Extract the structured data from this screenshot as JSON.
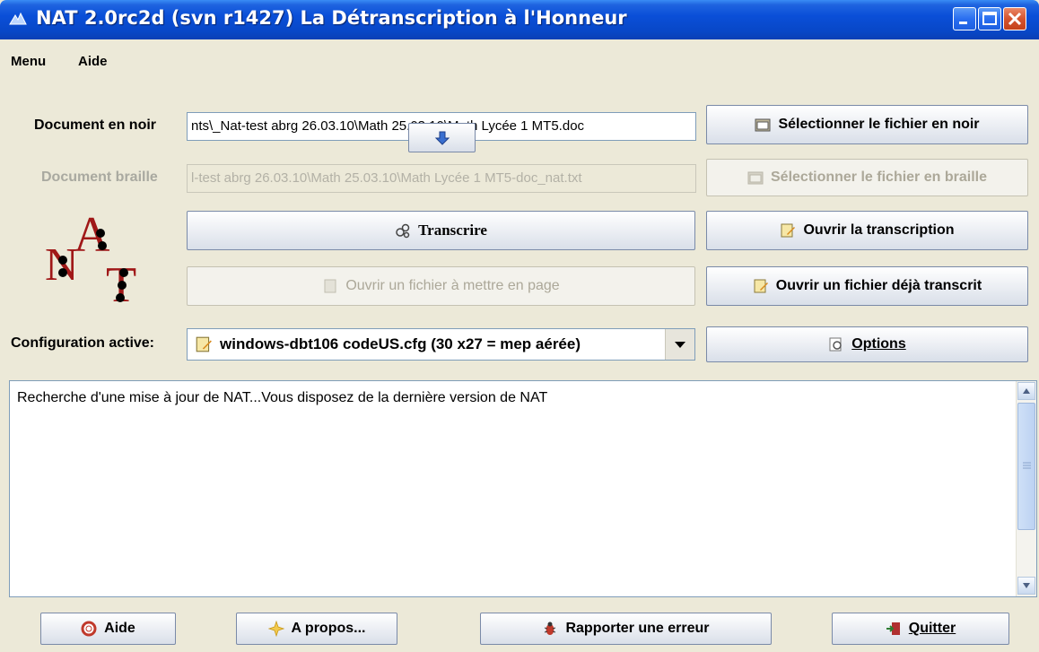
{
  "window": {
    "title": "NAT 2.0rc2d (svn r1427) La Détranscription à l'Honneur"
  },
  "menubar": {
    "menu_label": "Menu",
    "help_label": "Aide"
  },
  "document_noir": {
    "label": "Document en noir",
    "path": "nts\\_Nat-test abrg 26.03.10\\Math 25.03.10\\Math Lycée 1 MT5.doc",
    "select_button": "Sélectionner le fichier en noir"
  },
  "document_braille": {
    "label": "Document braille",
    "path": "l-test abrg 26.03.10\\Math 25.03.10\\Math Lycée 1 MT5-doc_nat.txt",
    "select_button": "Sélectionner le fichier en braille"
  },
  "actions": {
    "transcribe": "Transcrire",
    "open_transcription": "Ouvrir la transcription",
    "open_layout_file": "Ouvrir un fichier à mettre en page",
    "open_transcribed_file": "Ouvrir un fichier déjà transcrit"
  },
  "configuration": {
    "label": "Configuration active:",
    "selected": "windows-dbt106 codeUS.cfg (30 x27  =  mep aérée)",
    "options_button": "Options"
  },
  "console": {
    "text": "Recherche d'une mise à jour de NAT...Vous disposez de la dernière version de NAT"
  },
  "footer": {
    "help": "Aide",
    "about": "A propos...",
    "report_bug": "Rapporter une erreur",
    "quit": "Quitter"
  },
  "colors": {
    "titlebar": "#0a4fd8",
    "window_bg": "#ece9d8",
    "logo_red": "#a01818"
  }
}
